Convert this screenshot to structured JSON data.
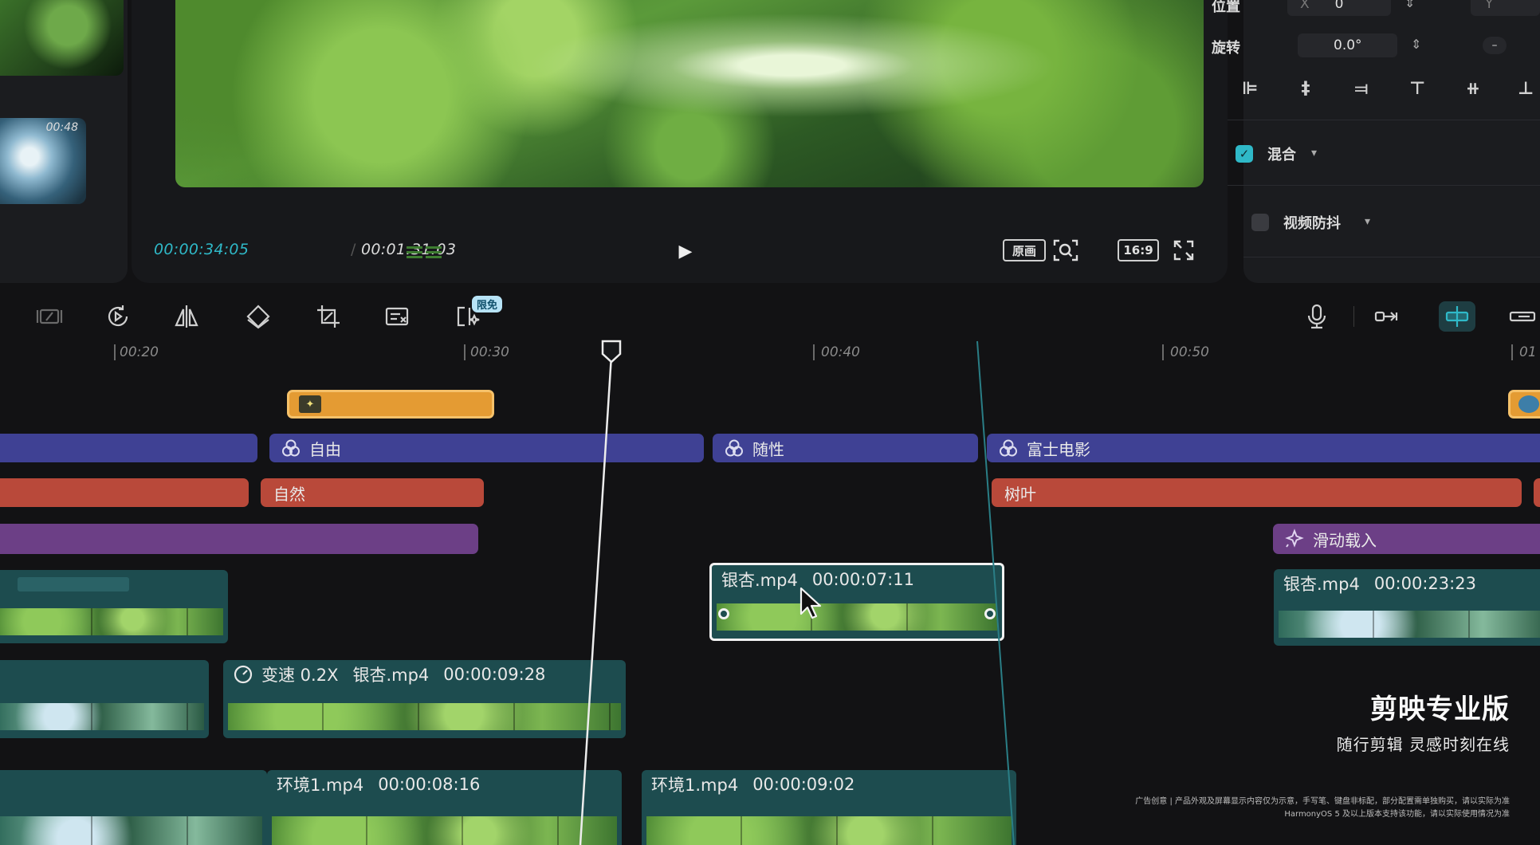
{
  "media": {
    "thumb_duration": "00:48"
  },
  "preview": {
    "current_time": "00:00:34:05",
    "separator": "/",
    "total_time": "00:01:31:03",
    "original_label": "原画",
    "ratio_label": "16:9",
    "icons": [
      "play-icon",
      "zoom-search-icon",
      "fullscreen-icon"
    ]
  },
  "properties": {
    "position_label": "位置",
    "position_x_axis": "X",
    "position_x": "0",
    "position_y_axis": "Y",
    "rotation_label": "旋转",
    "rotation_value": "0.0°",
    "blend_label": "混合",
    "stabilize_label": "视频防抖",
    "accent": "#2fb9c8"
  },
  "toolbar": {
    "free_badge": "限免"
  },
  "ruler": {
    "ticks": [
      "00:20",
      "00:30",
      "00:40",
      "00:50",
      "01"
    ]
  },
  "tracks": {
    "filters": [
      "自由",
      "随性",
      "富士电影"
    ],
    "texts": [
      "自然",
      "树叶"
    ],
    "animation": "滑动载入",
    "video_row1": [
      {
        "name": "银杏.mp4",
        "duration": "00:00:07:11"
      },
      {
        "name": "银杏.mp4",
        "duration": "00:00:23:23"
      }
    ],
    "video_row2": {
      "speed": "变速 0.2X",
      "name": "银杏.mp4",
      "duration": "00:00:09:28"
    },
    "video_row3": [
      {
        "name": "环境1.mp4",
        "duration": "00:00:08:16"
      },
      {
        "name": "环境1.mp4",
        "duration": "00:00:09:02"
      }
    ]
  },
  "branding": {
    "title": "剪映专业版",
    "slogan": "随行剪辑  灵感时刻在线",
    "disclaimer_1": "广告创意 | 产品外观及屏幕显示内容仅为示意，手写笔、键盘非标配，部分配置需单独购买，请以实际为准",
    "disclaimer_2": "HarmonyOS 5 及以上版本支持该功能，请以实际使用情况为准"
  }
}
